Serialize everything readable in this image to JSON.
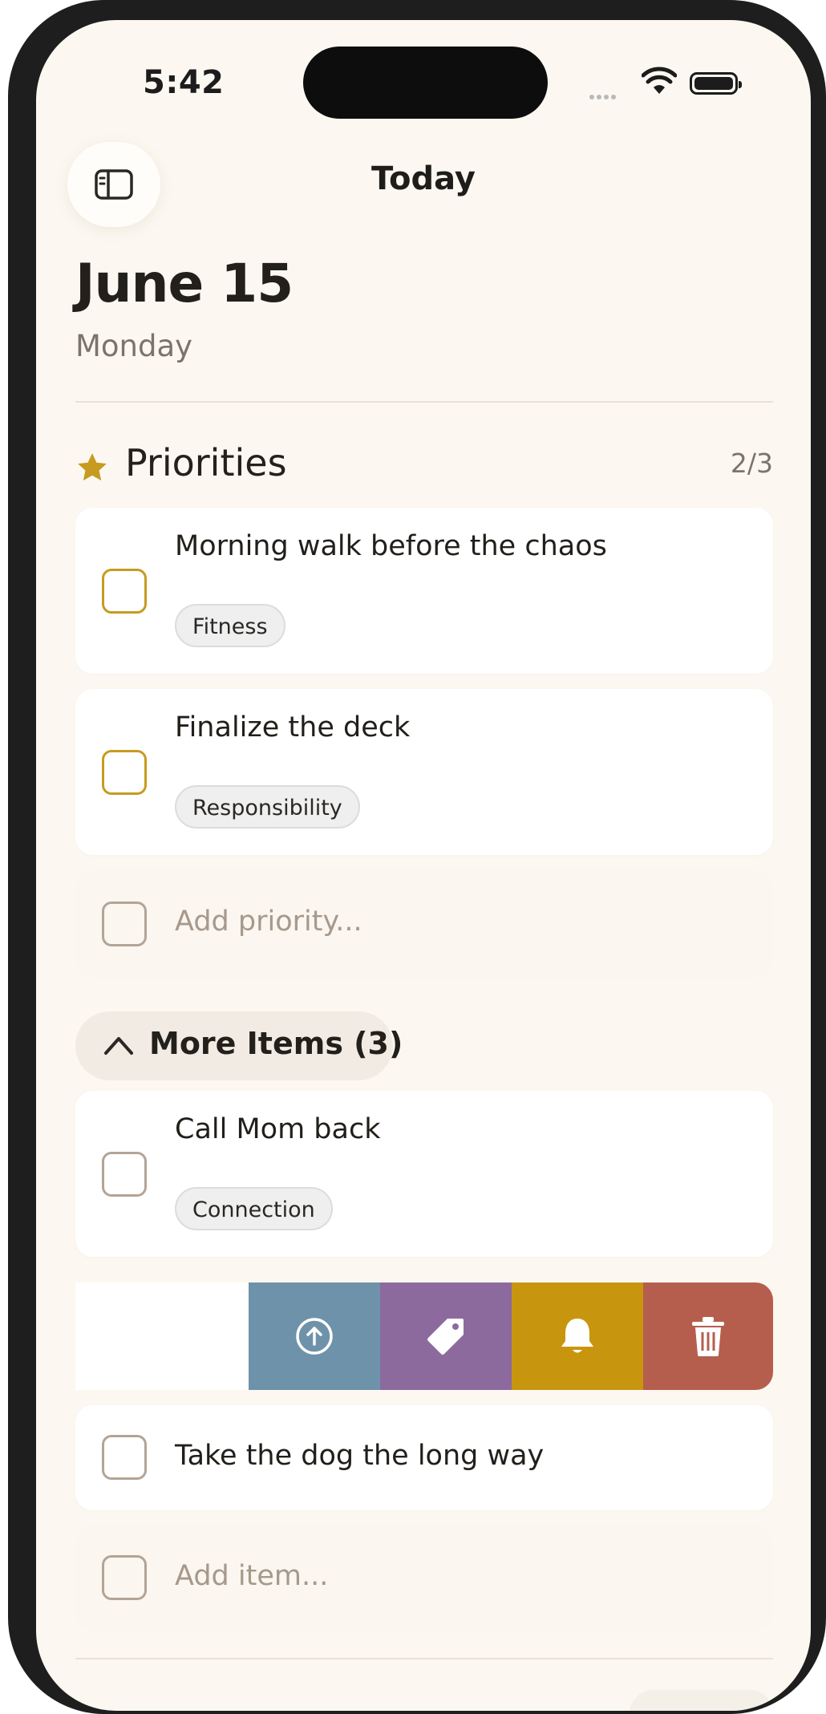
{
  "status_bar": {
    "time": "5:42"
  },
  "nav": {
    "title": "Today",
    "sidebar_icon": "sidebar-toggle-icon"
  },
  "header": {
    "date": "June 15",
    "weekday": "Monday"
  },
  "priorities": {
    "title": "Priorities",
    "count": "2/3",
    "icon": "star-icon",
    "accent_color": "#c79b1f",
    "items": [
      {
        "title": "Morning walk before the chaos",
        "tag": "Fitness"
      },
      {
        "title": "Finalize the deck",
        "tag": "Responsibility"
      }
    ],
    "add_placeholder": "Add priority..."
  },
  "more_items": {
    "label": "More Items (3)",
    "icon": "chevron-up-icon",
    "items": [
      {
        "title": "Call Mom back",
        "tag": "Connection"
      },
      {
        "title": "Take the dog the long way"
      }
    ],
    "add_placeholder": "Add item..."
  },
  "swipe_actions": [
    {
      "name": "move",
      "icon": "arrow-up-circle-icon",
      "color": "#6e92aa"
    },
    {
      "name": "tag",
      "icon": "tag-icon",
      "color": "#8c6a9e"
    },
    {
      "name": "remind",
      "icon": "bell-icon",
      "color": "#c8960e"
    },
    {
      "name": "delete",
      "icon": "trash-icon",
      "color": "#b65e4d"
    }
  ]
}
